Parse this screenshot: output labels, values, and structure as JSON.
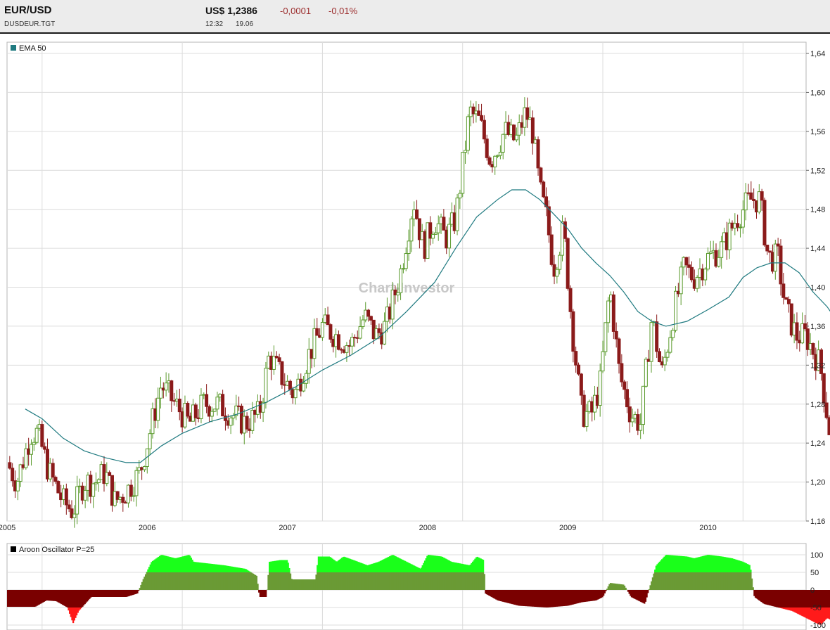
{
  "header": {
    "symbol": "EUR/USD",
    "code": "DUSDEUR.TGT",
    "price": "US$ 1,2386",
    "change": "-0,0001",
    "change_pct": "-0,01%",
    "time": "12:32",
    "date": "19.06"
  },
  "watermark": "Chart-Investor",
  "colors": {
    "up_candle": "#5a9a2c",
    "down_candle": "#8b1a1a",
    "ema": "#1f7a80",
    "aroon_pos_strong": "#1aff1a",
    "aroon_pos": "#6a9a35",
    "aroon_neg": "#7a0000",
    "aroon_neg_strong": "#ff1a1a",
    "grid": "#dcdcdc"
  },
  "chart_data": [
    {
      "type": "candlestick",
      "title": "",
      "legend": [
        "EMA 50"
      ],
      "xlabel": "",
      "ylabel": "",
      "ylim": [
        1.16,
        1.64
      ],
      "y_ticks": [
        "1,64",
        "1,60",
        "1,56",
        "1,52",
        "1,48",
        "1,44",
        "1,40",
        "1,36",
        "1,32",
        "1,28",
        "1,24",
        "1,20",
        "1,16"
      ],
      "x_ticks": [
        "2005",
        "2006",
        "2007",
        "2008",
        "2009",
        "2010"
      ],
      "x_tick_values": [
        2005.0,
        2006.0,
        2007.0,
        2008.0,
        2009.0,
        2010.0
      ],
      "xlim": [
        2004.75,
        2010.45
      ],
      "close_path": [
        [
          2004.75,
          1.22
        ],
        [
          2004.82,
          1.2
        ],
        [
          2004.92,
          1.25
        ],
        [
          2004.97,
          1.25
        ],
        [
          2005.05,
          1.21
        ],
        [
          2005.15,
          1.18
        ],
        [
          2005.22,
          1.17
        ],
        [
          2005.3,
          1.2
        ],
        [
          2005.38,
          1.2
        ],
        [
          2005.45,
          1.21
        ],
        [
          2005.52,
          1.18
        ],
        [
          2005.6,
          1.19
        ],
        [
          2005.7,
          1.21
        ],
        [
          2005.8,
          1.27
        ],
        [
          2005.85,
          1.3
        ],
        [
          2005.95,
          1.28
        ],
        [
          2006.05,
          1.26
        ],
        [
          2006.15,
          1.28
        ],
        [
          2006.25,
          1.28
        ],
        [
          2006.35,
          1.27
        ],
        [
          2006.45,
          1.26
        ],
        [
          2006.55,
          1.27
        ],
        [
          2006.62,
          1.33
        ],
        [
          2006.7,
          1.31
        ],
        [
          2006.8,
          1.29
        ],
        [
          2006.9,
          1.33
        ],
        [
          2007.0,
          1.36
        ],
        [
          2007.1,
          1.35
        ],
        [
          2007.2,
          1.34
        ],
        [
          2007.3,
          1.37
        ],
        [
          2007.38,
          1.35
        ],
        [
          2007.45,
          1.36
        ],
        [
          2007.55,
          1.41
        ],
        [
          2007.65,
          1.49
        ],
        [
          2007.72,
          1.44
        ],
        [
          2007.8,
          1.47
        ],
        [
          2007.88,
          1.45
        ],
        [
          2007.95,
          1.47
        ],
        [
          2008.05,
          1.58
        ],
        [
          2008.12,
          1.57
        ],
        [
          2008.2,
          1.53
        ],
        [
          2008.3,
          1.56
        ],
        [
          2008.38,
          1.55
        ],
        [
          2008.45,
          1.58
        ],
        [
          2008.5,
          1.56
        ],
        [
          2008.55,
          1.5
        ],
        [
          2008.6,
          1.47
        ],
        [
          2008.65,
          1.42
        ],
        [
          2008.72,
          1.46
        ],
        [
          2008.78,
          1.36
        ],
        [
          2008.85,
          1.27
        ],
        [
          2008.92,
          1.27
        ],
        [
          2008.98,
          1.3
        ],
        [
          2009.05,
          1.4
        ],
        [
          2009.12,
          1.31
        ],
        [
          2009.2,
          1.27
        ],
        [
          2009.27,
          1.26
        ],
        [
          2009.35,
          1.37
        ],
        [
          2009.42,
          1.31
        ],
        [
          2009.5,
          1.37
        ],
        [
          2009.58,
          1.42
        ],
        [
          2009.65,
          1.41
        ],
        [
          2009.75,
          1.43
        ],
        [
          2009.85,
          1.44
        ],
        [
          2009.95,
          1.47
        ],
        [
          2010.05,
          1.49
        ],
        [
          2010.12,
          1.49
        ],
        [
          2010.18,
          1.43
        ],
        [
          2010.25,
          1.43
        ],
        [
          2010.3,
          1.38
        ],
        [
          2010.38,
          1.35
        ],
        [
          2010.45,
          1.35
        ],
        [
          2010.55,
          1.32
        ],
        [
          2010.62,
          1.25
        ],
        [
          2010.68,
          1.2
        ],
        [
          2010.72,
          1.23
        ]
      ],
      "ema_50": [
        [
          2004.88,
          1.275
        ],
        [
          2005.0,
          1.265
        ],
        [
          2005.15,
          1.245
        ],
        [
          2005.3,
          1.232
        ],
        [
          2005.45,
          1.225
        ],
        [
          2005.6,
          1.22
        ],
        [
          2005.7,
          1.22
        ],
        [
          2005.85,
          1.237
        ],
        [
          2006.0,
          1.25
        ],
        [
          2006.2,
          1.262
        ],
        [
          2006.4,
          1.27
        ],
        [
          2006.6,
          1.282
        ],
        [
          2006.8,
          1.297
        ],
        [
          2007.0,
          1.315
        ],
        [
          2007.2,
          1.33
        ],
        [
          2007.4,
          1.348
        ],
        [
          2007.6,
          1.375
        ],
        [
          2007.8,
          1.405
        ],
        [
          2007.95,
          1.44
        ],
        [
          2008.1,
          1.472
        ],
        [
          2008.25,
          1.49
        ],
        [
          2008.35,
          1.5
        ],
        [
          2008.45,
          1.5
        ],
        [
          2008.55,
          1.49
        ],
        [
          2008.65,
          1.475
        ],
        [
          2008.75,
          1.46
        ],
        [
          2008.85,
          1.44
        ],
        [
          2008.95,
          1.425
        ],
        [
          2009.05,
          1.412
        ],
        [
          2009.15,
          1.395
        ],
        [
          2009.25,
          1.375
        ],
        [
          2009.35,
          1.365
        ],
        [
          2009.45,
          1.36
        ],
        [
          2009.6,
          1.365
        ],
        [
          2009.75,
          1.377
        ],
        [
          2009.9,
          1.39
        ],
        [
          2010.0,
          1.41
        ],
        [
          2010.1,
          1.42
        ],
        [
          2010.2,
          1.425
        ],
        [
          2010.3,
          1.425
        ],
        [
          2010.4,
          1.415
        ],
        [
          2010.5,
          1.395
        ],
        [
          2010.6,
          1.38
        ],
        [
          2010.72,
          1.355
        ]
      ]
    },
    {
      "type": "area",
      "title": "",
      "legend": [
        "Aroon Oscillator P=25"
      ],
      "ylim": [
        -100,
        100
      ],
      "y_ticks": [
        "100",
        "50",
        "0",
        "-50",
        "-100"
      ],
      "series": [
        {
          "values": [
            [
              2004.75,
              -48
            ],
            [
              2004.95,
              -48
            ],
            [
              2005.03,
              -30
            ],
            [
              2005.1,
              -32
            ],
            [
              2005.18,
              -50
            ],
            [
              2005.22,
              -95
            ],
            [
              2005.26,
              -60
            ],
            [
              2005.35,
              -20
            ],
            [
              2005.45,
              -20
            ],
            [
              2005.6,
              -20
            ],
            [
              2005.68,
              -10
            ],
            [
              2005.72,
              30
            ],
            [
              2005.78,
              80
            ],
            [
              2005.85,
              100
            ],
            [
              2005.95,
              90
            ],
            [
              2006.05,
              100
            ],
            [
              2006.08,
              80
            ],
            [
              2006.3,
              70
            ],
            [
              2006.45,
              60
            ],
            [
              2006.53,
              40
            ],
            [
              2006.55,
              -20
            ],
            [
              2006.6,
              -20
            ],
            [
              2006.62,
              80
            ],
            [
              2006.7,
              85
            ],
            [
              2006.75,
              85
            ],
            [
              2006.78,
              30
            ],
            [
              2006.9,
              30
            ],
            [
              2006.95,
              30
            ],
            [
              2006.97,
              95
            ],
            [
              2007.05,
              95
            ],
            [
              2007.1,
              80
            ],
            [
              2007.15,
              95
            ],
            [
              2007.22,
              85
            ],
            [
              2007.32,
              70
            ],
            [
              2007.4,
              80
            ],
            [
              2007.45,
              90
            ],
            [
              2007.5,
              100
            ],
            [
              2007.55,
              90
            ],
            [
              2007.6,
              80
            ],
            [
              2007.7,
              60
            ],
            [
              2007.75,
              100
            ],
            [
              2007.85,
              95
            ],
            [
              2007.92,
              80
            ],
            [
              2008.05,
              70
            ],
            [
              2008.1,
              95
            ],
            [
              2008.15,
              85
            ],
            [
              2008.16,
              -10
            ],
            [
              2008.25,
              -30
            ],
            [
              2008.4,
              -45
            ],
            [
              2008.6,
              -50
            ],
            [
              2008.75,
              -45
            ],
            [
              2008.85,
              -35
            ],
            [
              2008.95,
              -30
            ],
            [
              2009.0,
              -20
            ],
            [
              2009.05,
              20
            ],
            [
              2009.15,
              15
            ],
            [
              2009.2,
              -20
            ],
            [
              2009.3,
              -40
            ],
            [
              2009.32,
              -10
            ],
            [
              2009.38,
              70
            ],
            [
              2009.45,
              100
            ],
            [
              2009.6,
              95
            ],
            [
              2009.65,
              90
            ],
            [
              2009.75,
              100
            ],
            [
              2009.85,
              95
            ],
            [
              2009.92,
              90
            ],
            [
              2010.0,
              80
            ],
            [
              2010.05,
              70
            ],
            [
              2010.08,
              -20
            ],
            [
              2010.15,
              -40
            ],
            [
              2010.25,
              -50
            ],
            [
              2010.35,
              -60
            ],
            [
              2010.45,
              -80
            ],
            [
              2010.55,
              -100
            ],
            [
              2010.6,
              -80
            ],
            [
              2010.65,
              -90
            ],
            [
              2010.72,
              -90
            ]
          ]
        }
      ]
    }
  ]
}
